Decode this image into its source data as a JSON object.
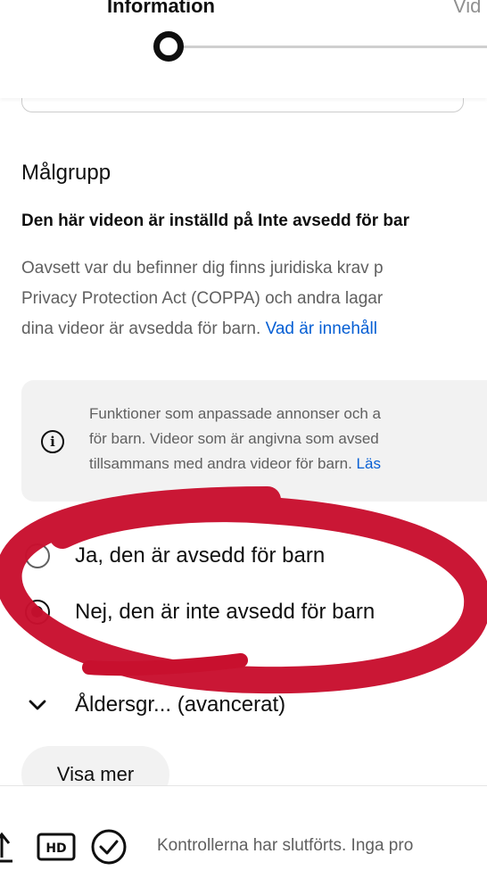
{
  "stepper": {
    "step1_label": "Information",
    "step2_label": "Vid"
  },
  "audience": {
    "heading": "Målgrupp",
    "setting_line": "Den här videon är inställd på Inte avsedd för bar",
    "description_lines": [
      "Oavsett var du befinner dig finns juridiska krav p",
      "Privacy Protection Act (COPPA) och andra lagar",
      "dina videor är avsedda för barn. "
    ],
    "links": {
      "what_is_content": "Vad är innehåll",
      "more_info": "Läs"
    },
    "info_box_lines": [
      "Funktioner som anpassade annonser och a",
      "för barn. Videor som är angivna som avsed",
      "tillsammans med andra videor för barn. "
    ],
    "options": [
      {
        "label": "Ja, den är avsedd för barn",
        "selected": false
      },
      {
        "label": "Nej, den är inte avsedd för barn",
        "selected": true
      }
    ]
  },
  "age_restriction": {
    "label": "Åldersgr... (avancerat)"
  },
  "buttons": {
    "show_more": "Visa mer"
  },
  "footer": {
    "status_text": "Kontrollerna har slutförts. Inga pro",
    "icons": [
      "upload-icon",
      "hd-icon",
      "check-circle-icon"
    ]
  },
  "colors": {
    "link": "#065fd4",
    "annotation_red": "#c8102e",
    "secondary_text": "#606060"
  }
}
